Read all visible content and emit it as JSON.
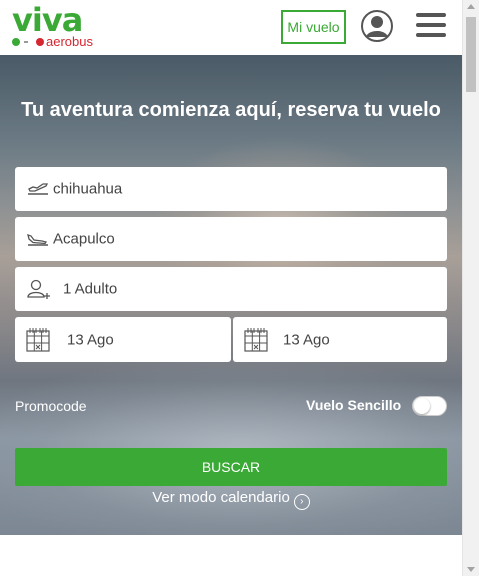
{
  "brand": {
    "name": "viva",
    "sub": "aerobus",
    "colors": {
      "green": "#3aa935",
      "red": "#d6262f"
    }
  },
  "header": {
    "mi_vuelo_label": "Mi vuelo",
    "icons": [
      "user-avatar-icon",
      "hamburger-menu-icon"
    ]
  },
  "hero": {
    "title": "Tu aventura comienza aquí, reserva tu vuelo"
  },
  "search": {
    "origin": {
      "value": "chihuahua",
      "icon": "plane-takeoff-icon"
    },
    "destination": {
      "value": "Acapulco",
      "icon": "plane-landing-icon"
    },
    "passengers": {
      "value": "1 Adulto",
      "icon": "add-person-icon"
    },
    "departure_date": {
      "value": "13 Ago",
      "icon": "calendar-icon"
    },
    "return_date": {
      "value": "13 Ago",
      "icon": "calendar-icon"
    },
    "promocode_label": "Promocode",
    "one_way_label": "Vuelo Sencillo",
    "one_way_enabled": false,
    "submit_label": "BUSCAR",
    "calendar_mode_label": "Ver modo calendario"
  }
}
